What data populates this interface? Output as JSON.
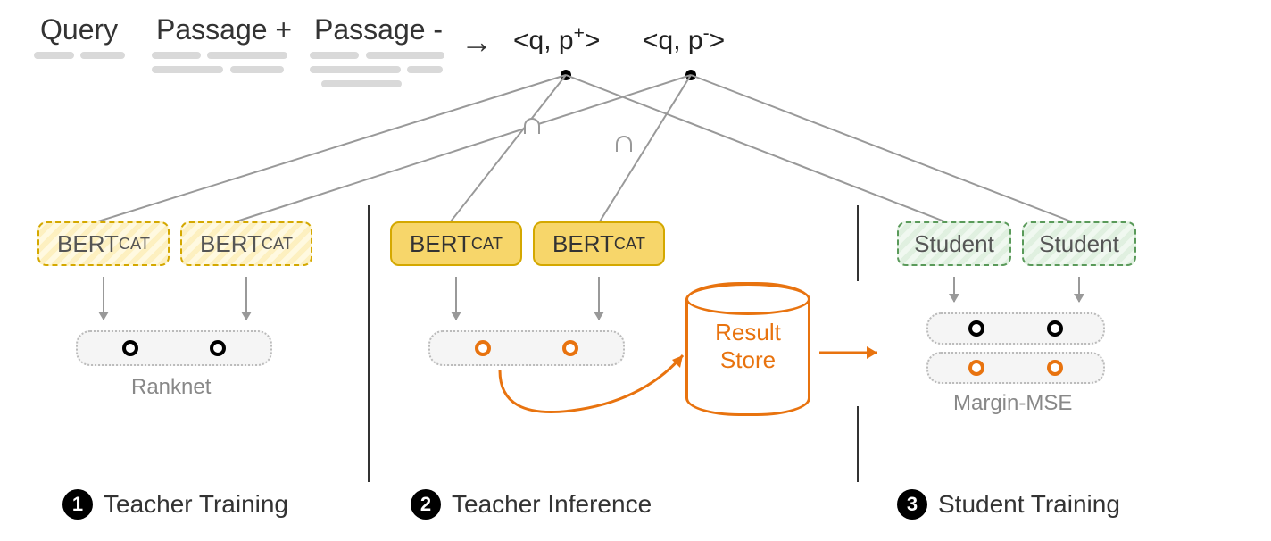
{
  "top": {
    "query": "Query",
    "passage_pos": "Passage +",
    "passage_neg": "Passage -",
    "pair_pos": "<q, p⁺>",
    "pair_neg": "<q, p⁻>"
  },
  "phase1": {
    "model_label_html": "BERT<span class='subscript'>CAT</span>",
    "loss": "Ranknet",
    "title": "Teacher Training",
    "num": "1"
  },
  "phase2": {
    "model_label_html": "BERT<span class='subscript'>CAT</span>",
    "store": "Result\nStore",
    "title": "Teacher Inference",
    "num": "2"
  },
  "phase3": {
    "model_label": "Student",
    "loss": "Margin-MSE",
    "title": "Student Training",
    "num": "3"
  }
}
